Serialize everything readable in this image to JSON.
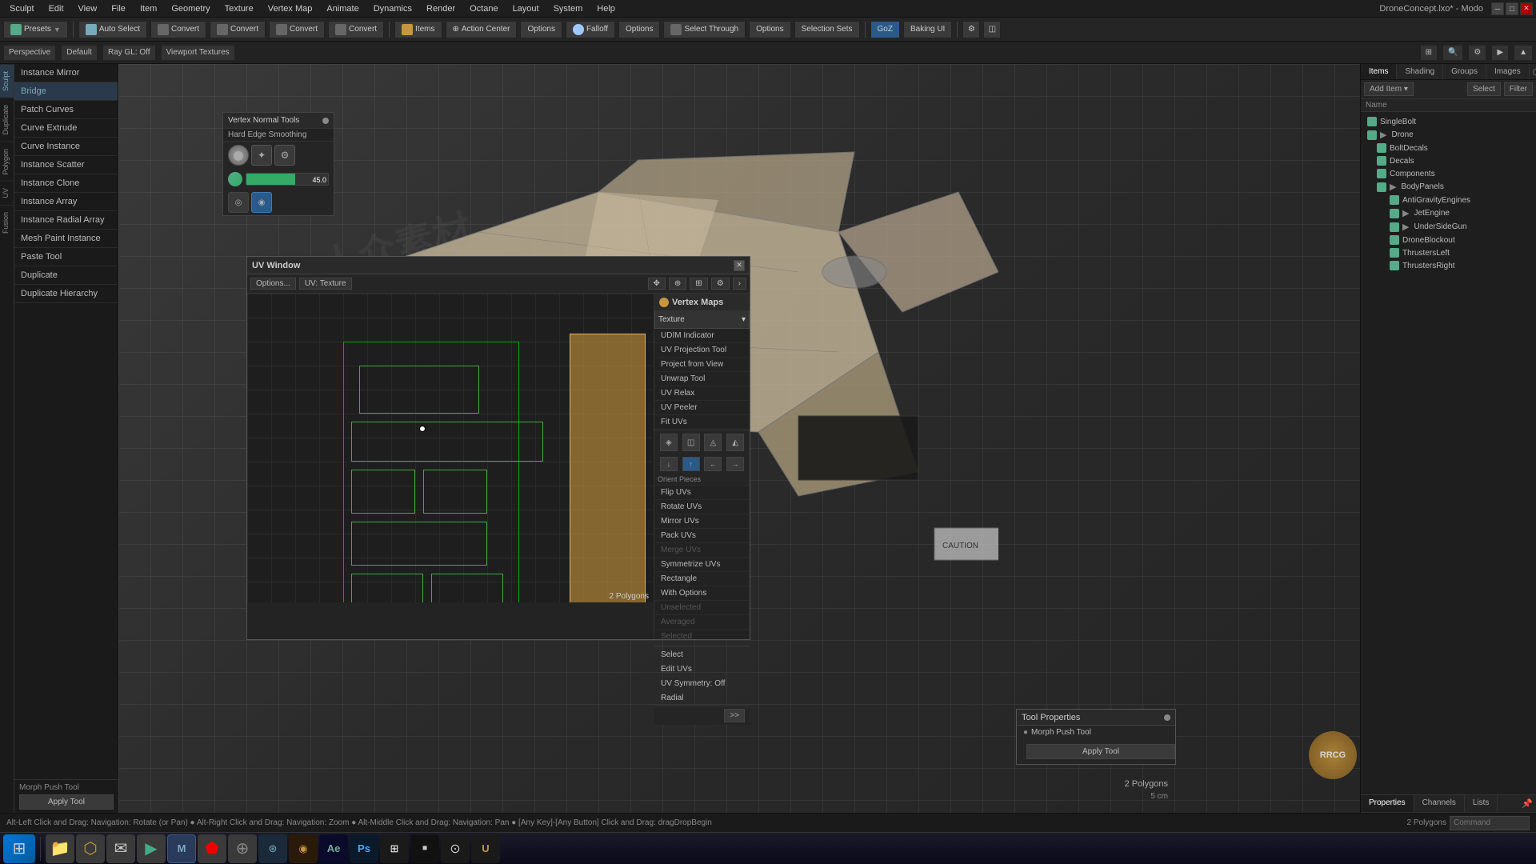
{
  "app": {
    "title": "DroneConcept.lxo* - Modo",
    "window_controls": [
      "minimize",
      "maximize",
      "close"
    ]
  },
  "menu": {
    "items": [
      "Sculpt",
      "Edit",
      "View",
      "File",
      "Item",
      "Geometry",
      "Texture",
      "Vertex Map",
      "Animate",
      "Dynamics",
      "Render",
      "Octane",
      "Layout",
      "System",
      "Help"
    ]
  },
  "toolbar": {
    "presets_label": "Presets",
    "buttons": [
      {
        "label": "Auto Select",
        "active": false
      },
      {
        "label": "Convert",
        "active": false
      },
      {
        "label": "Convert",
        "active": false
      },
      {
        "label": "Convert",
        "active": false
      },
      {
        "label": "Convert",
        "active": false
      },
      {
        "label": "Items",
        "active": false
      },
      {
        "label": "Action Center",
        "active": false
      },
      {
        "label": "Options",
        "active": false
      },
      {
        "label": "Falloff",
        "active": false
      },
      {
        "label": "Options",
        "active": false
      },
      {
        "label": "Select Through",
        "active": false
      },
      {
        "label": "Options",
        "active": false
      },
      {
        "label": "Selection Sets",
        "active": false
      },
      {
        "label": "GoZ",
        "active": false
      },
      {
        "label": "Baking UI",
        "active": false
      }
    ]
  },
  "toolbar2": {
    "buttons": [
      "Perspective",
      "Default",
      "Ray GL: Off",
      "Viewport Textures"
    ]
  },
  "sidebar_left": {
    "items": [
      {
        "label": "Instance Mirror",
        "active": false
      },
      {
        "label": "Bridge",
        "active": false
      },
      {
        "label": "Patch Curves",
        "active": false
      },
      {
        "label": "Curve Extrude",
        "active": false
      },
      {
        "label": "Curve Instance",
        "active": false
      },
      {
        "label": "Instance Scatter",
        "active": false
      },
      {
        "label": "Instance Clone",
        "active": false
      },
      {
        "label": "Instance Array",
        "active": false
      },
      {
        "label": "Instance Radial Array",
        "active": false
      },
      {
        "label": "Mesh Paint Instance",
        "active": false
      },
      {
        "label": "Paste Tool",
        "active": false
      },
      {
        "label": "Duplicate",
        "active": false
      },
      {
        "label": "Duplicate Hierarchy",
        "active": false
      }
    ],
    "panel_tabs": [
      "Sculpt",
      "Duplicate",
      "Polygon",
      "UV",
      "Fusion"
    ]
  },
  "side_tabs": {
    "items": [
      "Sculpt",
      "Duplicate",
      "Polygon",
      "UV",
      "Fusion"
    ]
  },
  "vertex_normal_panel": {
    "title": "Vertex Normal Tools",
    "sub_title": "Hard Edge Smoothing",
    "icons": [
      "circle-icon",
      "star-icon",
      "gear-icon"
    ],
    "slider_value": "45.0",
    "bottom_icons": [
      "sphere-icon",
      "sphere2-icon"
    ]
  },
  "uv_window": {
    "title": "UV Window",
    "toolbar": {
      "options_btn": "Options...",
      "uv_texture": "UV: Texture"
    },
    "status": "2 Polygons"
  },
  "vertex_maps": {
    "title": "Vertex Maps",
    "dropdown": "Texture",
    "items": [
      {
        "label": "UDIM Indicator"
      },
      {
        "label": "UV Projection Tool"
      },
      {
        "label": "Project from View"
      },
      {
        "label": "Unwrap Tool"
      },
      {
        "label": "UV Relax"
      },
      {
        "label": "UV Peeler"
      },
      {
        "label": "Fit UVs"
      }
    ],
    "section_orient": "Orient Pieces",
    "orient_items": [
      {
        "label": "Flip UVs"
      },
      {
        "label": "Rotate UVs"
      },
      {
        "label": "Mirror UVs"
      },
      {
        "label": "Pack UVs"
      },
      {
        "label": "Merge UVs",
        "disabled": true
      },
      {
        "label": "Symmetrize UVs"
      },
      {
        "label": "Rectangle"
      },
      {
        "label": "With Options"
      },
      {
        "label": "Unselected",
        "disabled": true
      },
      {
        "label": "Averaged",
        "disabled": true
      },
      {
        "label": "Selected",
        "disabled": true
      }
    ],
    "bottom_items": [
      {
        "label": "Select"
      },
      {
        "label": "Edit UVs"
      },
      {
        "label": "UV Symmetry: Off"
      },
      {
        "label": "Radial"
      }
    ]
  },
  "right_sidebar": {
    "tabs": [
      "Items",
      "Shading",
      "Groups",
      "Images"
    ],
    "header_buttons": [
      "Add Item",
      "Select",
      "Filter"
    ],
    "columns": [
      "Name"
    ],
    "items": [
      {
        "name": "SingleBolt",
        "level": 0,
        "visible": true
      },
      {
        "name": "Drone",
        "level": 0,
        "visible": true
      },
      {
        "name": "BoltDecals",
        "level": 1,
        "visible": true
      },
      {
        "name": "Decals",
        "level": 1,
        "visible": true
      },
      {
        "name": "Components",
        "level": 1,
        "visible": true
      },
      {
        "name": "BodyPanels",
        "level": 1,
        "visible": true
      },
      {
        "name": "AntiGravityEngines",
        "level": 2,
        "visible": true
      },
      {
        "name": "JetEngine",
        "level": 2,
        "visible": true
      },
      {
        "name": "UnderSideGun",
        "level": 2,
        "visible": true
      },
      {
        "name": "DroneBlockout",
        "level": 2,
        "visible": true
      },
      {
        "name": "ThrustersLeft",
        "level": 2,
        "visible": true
      },
      {
        "name": "ThrustersRight",
        "level": 2,
        "visible": true
      }
    ]
  },
  "properties_panel": {
    "title": "Tool Properties",
    "tool_name": "Morph Push Tool",
    "apply_btn": "Apply Tool"
  },
  "tool_panel": {
    "title": "Morph Push Tool",
    "apply_btn": "Apply Tool"
  },
  "status_bar": {
    "text": "Alt-Left Click and Drag: Navigation: Rotate (or Pan) ● Alt-Right Click and Drag: Navigation: Zoom ● Alt-Middle Click and Drag: Navigation: Pan ● [Any Key]-[Any Button] Click and Drag: dragDropBegin"
  },
  "viewport": {
    "polygon_count": "2 Polygons",
    "distance": "5 cm",
    "command_label": "Command"
  },
  "taskbar": {
    "items": [
      "start",
      "folder",
      "browser",
      "mail",
      "media",
      "settings",
      "search",
      "steam",
      "blender",
      "ae",
      "photoshop",
      "ps",
      "epic",
      "chrome",
      "unreal"
    ]
  }
}
